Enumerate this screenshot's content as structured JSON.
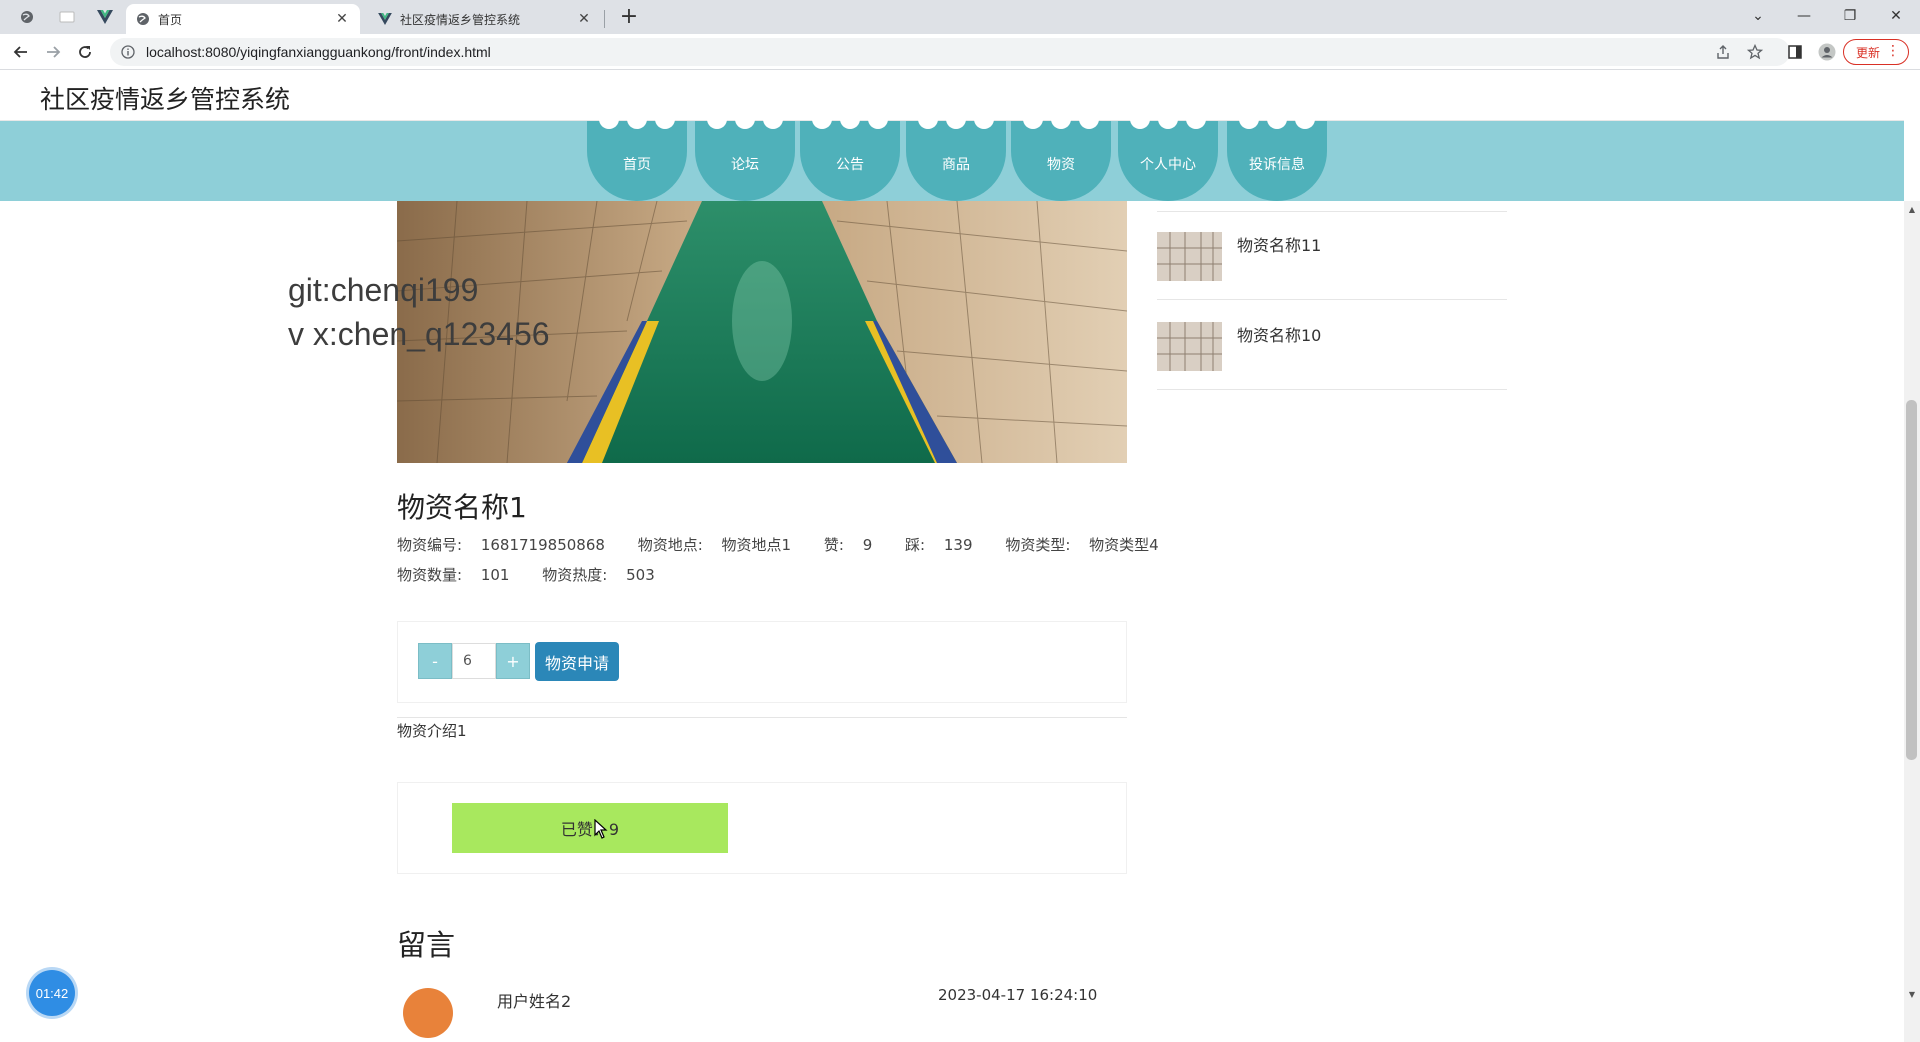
{
  "browser": {
    "tabs": [
      {
        "title": "首页",
        "active": true
      },
      {
        "title": "社区疫情返乡管控系统",
        "active": false
      }
    ],
    "url": "localhost:8080/yiqingfanxiangguankong/front/index.html",
    "update_label": "更新"
  },
  "site": {
    "title": "社区疫情返乡管控系统",
    "nav": [
      "首页",
      "论坛",
      "公告",
      "商品",
      "物资",
      "个人中心",
      "投诉信息"
    ]
  },
  "watermark": {
    "line1": "git:chenqi199",
    "line2": "v x:chen_q123456"
  },
  "sidebar": {
    "items": [
      {
        "name": "物资名称11"
      },
      {
        "name": "物资名称10"
      }
    ]
  },
  "product": {
    "name": "物资名称1",
    "code_label": "物资编号:",
    "code": "1681719850868",
    "location_label": "物资地点:",
    "location": "物资地点1",
    "like_label": "赞:",
    "likes": "9",
    "dislike_label": "踩:",
    "dislikes": "139",
    "type_label": "物资类型:",
    "type": "物资类型4",
    "qty_label": "物资数量:",
    "qty": "101",
    "heat_label": "物资热度:",
    "heat": "503",
    "intro": "物资介绍1"
  },
  "order": {
    "minus": "-",
    "quantity": "6",
    "plus": "+",
    "apply_label": "物资申请"
  },
  "like_button": "已赞：9",
  "messages": {
    "title": "留言",
    "items": [
      {
        "user": "用户姓名2",
        "time": "2023-04-17 16:24:10"
      }
    ]
  },
  "timer": "01:42",
  "colors": {
    "nav_bg": "#8ecfd8",
    "nav_item": "#4fb1ba",
    "apply_button": "#2b87b8",
    "like_button": "#a8e85e"
  }
}
